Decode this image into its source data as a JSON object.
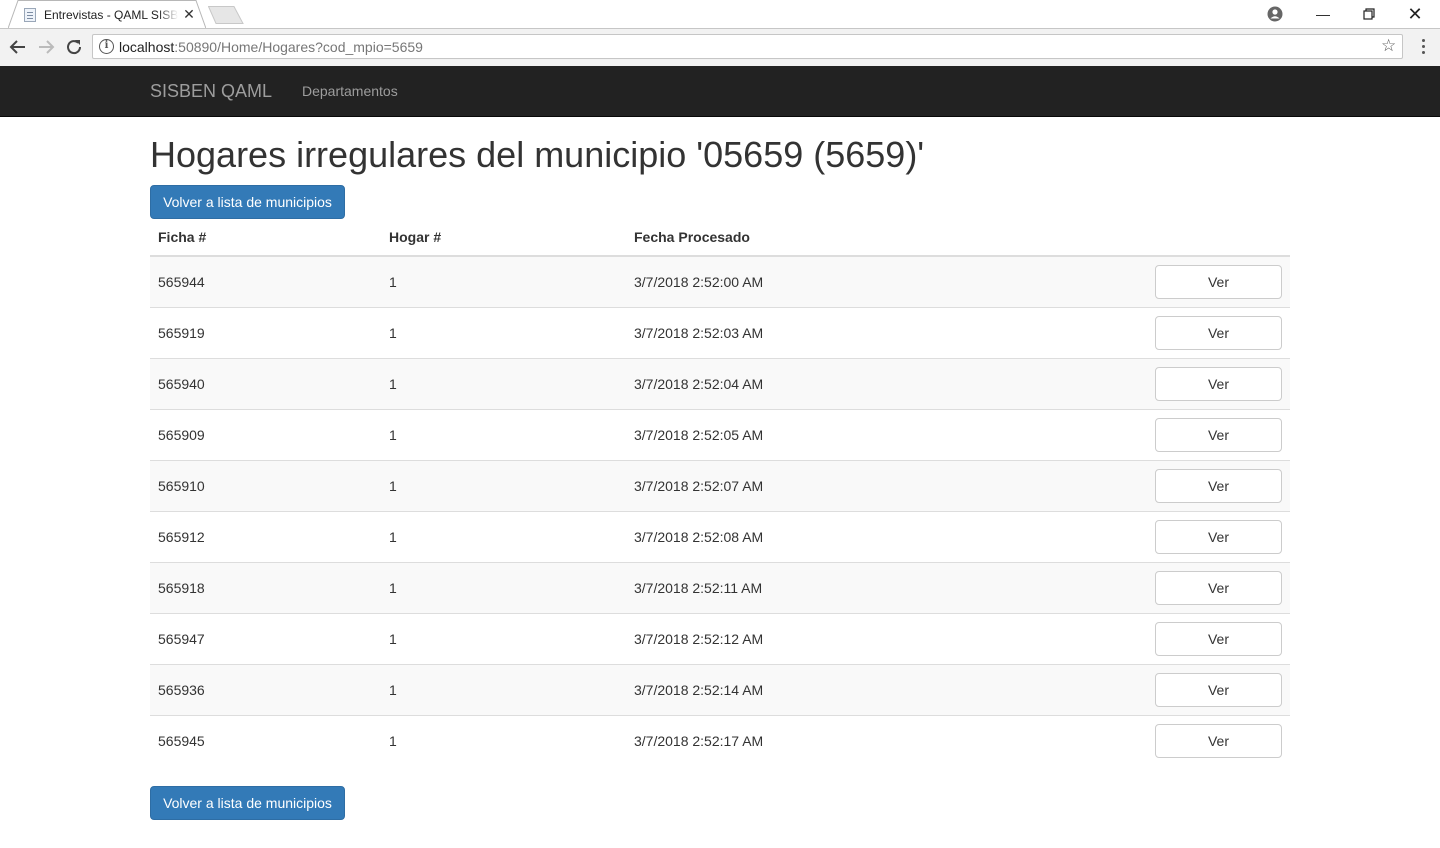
{
  "browser": {
    "tab_title": "Entrevistas - QAML SISBEN",
    "url_host": "localhost",
    "url_rest": ":50890/Home/Hogares?cod_mpio=5659"
  },
  "navbar": {
    "brand": "SISBEN QAML",
    "links": [
      "Departamentos"
    ]
  },
  "page": {
    "title": "Hogares irregulares del municipio '05659 (5659)'",
    "back_button": "Volver a lista de municipios"
  },
  "table": {
    "headers": [
      "Ficha #",
      "Hogar #",
      "Fecha Procesado"
    ],
    "action_label": "Ver",
    "rows": [
      [
        "565944",
        "1",
        "3/7/2018 2:52:00 AM"
      ],
      [
        "565919",
        "1",
        "3/7/2018 2:52:03 AM"
      ],
      [
        "565940",
        "1",
        "3/7/2018 2:52:04 AM"
      ],
      [
        "565909",
        "1",
        "3/7/2018 2:52:05 AM"
      ],
      [
        "565910",
        "1",
        "3/7/2018 2:52:07 AM"
      ],
      [
        "565912",
        "1",
        "3/7/2018 2:52:08 AM"
      ],
      [
        "565918",
        "1",
        "3/7/2018 2:52:11 AM"
      ],
      [
        "565947",
        "1",
        "3/7/2018 2:52:12 AM"
      ],
      [
        "565936",
        "1",
        "3/7/2018 2:52:14 AM"
      ],
      [
        "565945",
        "1",
        "3/7/2018 2:52:17 AM"
      ]
    ]
  },
  "colors": {
    "navbar_bg": "#222222",
    "primary": "#337ab7",
    "striped_row": "#f9f9f9"
  }
}
